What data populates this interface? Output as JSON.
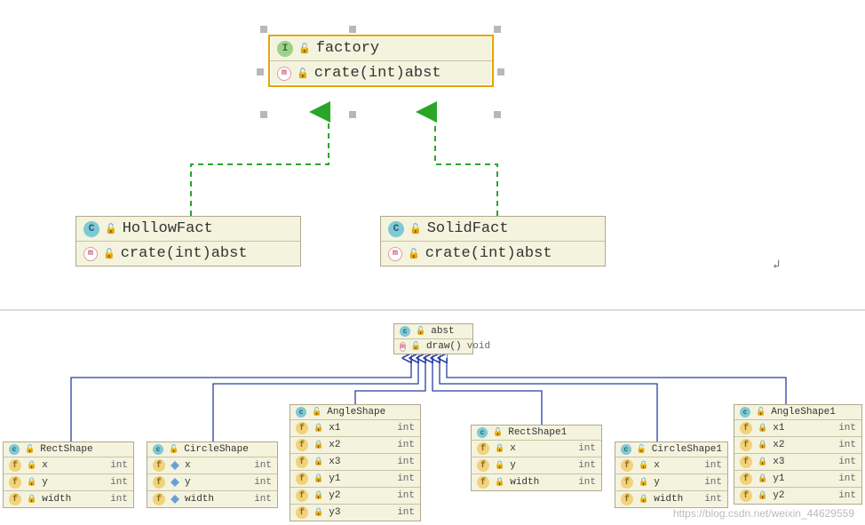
{
  "upper": {
    "factory": {
      "name": "factory",
      "method": "crate(int)abst",
      "kind": "I"
    },
    "hollow": {
      "name": "HollowFact",
      "method": "crate(int)abst",
      "kind": "C"
    },
    "solid": {
      "name": "SolidFact",
      "method": "crate(int)abst",
      "kind": "C"
    }
  },
  "lower": {
    "abst": {
      "name": "abst",
      "method": "draw()",
      "ret": "void"
    },
    "rect": {
      "name": "RectShape",
      "fields": [
        {
          "n": "x",
          "t": "int"
        },
        {
          "n": "y",
          "t": "int"
        },
        {
          "n": "width",
          "t": "int"
        }
      ]
    },
    "circle": {
      "name": "CircleShape",
      "fields": [
        {
          "n": "x",
          "t": "int"
        },
        {
          "n": "y",
          "t": "int"
        },
        {
          "n": "width",
          "t": "int"
        }
      ]
    },
    "angle": {
      "name": "AngleShape",
      "fields": [
        {
          "n": "x1",
          "t": "int"
        },
        {
          "n": "x2",
          "t": "int"
        },
        {
          "n": "x3",
          "t": "int"
        },
        {
          "n": "y1",
          "t": "int"
        },
        {
          "n": "y2",
          "t": "int"
        },
        {
          "n": "y3",
          "t": "int"
        }
      ]
    },
    "rect1": {
      "name": "RectShape1",
      "fields": [
        {
          "n": "x",
          "t": "int"
        },
        {
          "n": "y",
          "t": "int"
        },
        {
          "n": "width",
          "t": "int"
        }
      ]
    },
    "circle1": {
      "name": "CircleShape1",
      "fields": [
        {
          "n": "x",
          "t": "int"
        },
        {
          "n": "y",
          "t": "int"
        },
        {
          "n": "width",
          "t": "int"
        }
      ]
    },
    "angle1": {
      "name": "AngleShape1",
      "fields": [
        {
          "n": "x1",
          "t": "int"
        },
        {
          "n": "x2",
          "t": "int"
        },
        {
          "n": "x3",
          "t": "int"
        },
        {
          "n": "y1",
          "t": "int"
        },
        {
          "n": "y2",
          "t": "int"
        }
      ]
    }
  },
  "watermark": "https://blog.csdn.net/weixin_44629559",
  "chart_data": {
    "type": "uml-class-diagram",
    "diagrams": [
      {
        "title": "factory hierarchy",
        "nodes": [
          {
            "id": "factory",
            "stereotype": "interface",
            "name": "factory",
            "methods": [
              "crate(int) : abst"
            ]
          },
          {
            "id": "HollowFact",
            "stereotype": "class",
            "name": "HollowFact",
            "methods": [
              "crate(int) : abst"
            ]
          },
          {
            "id": "SolidFact",
            "stereotype": "class",
            "name": "SolidFact",
            "methods": [
              "crate(int) : abst"
            ]
          }
        ],
        "edges": [
          {
            "from": "HollowFact",
            "to": "factory",
            "kind": "realization"
          },
          {
            "from": "SolidFact",
            "to": "factory",
            "kind": "realization"
          }
        ]
      },
      {
        "title": "abst hierarchy",
        "nodes": [
          {
            "id": "abst",
            "stereotype": "class",
            "name": "abst",
            "methods": [
              "draw() : void"
            ]
          },
          {
            "id": "RectShape",
            "name": "RectShape",
            "fields": [
              [
                "x",
                "int"
              ],
              [
                "y",
                "int"
              ],
              [
                "width",
                "int"
              ]
            ]
          },
          {
            "id": "CircleShape",
            "name": "CircleShape",
            "fields": [
              [
                "x",
                "int"
              ],
              [
                "y",
                "int"
              ],
              [
                "width",
                "int"
              ]
            ]
          },
          {
            "id": "AngleShape",
            "name": "AngleShape",
            "fields": [
              [
                "x1",
                "int"
              ],
              [
                "x2",
                "int"
              ],
              [
                "x3",
                "int"
              ],
              [
                "y1",
                "int"
              ],
              [
                "y2",
                "int"
              ],
              [
                "y3",
                "int"
              ]
            ]
          },
          {
            "id": "RectShape1",
            "name": "RectShape1",
            "fields": [
              [
                "x",
                "int"
              ],
              [
                "y",
                "int"
              ],
              [
                "width",
                "int"
              ]
            ]
          },
          {
            "id": "CircleShape1",
            "name": "CircleShape1",
            "fields": [
              [
                "x",
                "int"
              ],
              [
                "y",
                "int"
              ],
              [
                "width",
                "int"
              ]
            ]
          },
          {
            "id": "AngleShape1",
            "name": "AngleShape1",
            "fields": [
              [
                "x1",
                "int"
              ],
              [
                "x2",
                "int"
              ],
              [
                "x3",
                "int"
              ],
              [
                "y1",
                "int"
              ],
              [
                "y2",
                "int"
              ]
            ]
          }
        ],
        "edges": [
          {
            "from": "RectShape",
            "to": "abst",
            "kind": "generalization"
          },
          {
            "from": "CircleShape",
            "to": "abst",
            "kind": "generalization"
          },
          {
            "from": "AngleShape",
            "to": "abst",
            "kind": "generalization"
          },
          {
            "from": "RectShape1",
            "to": "abst",
            "kind": "generalization"
          },
          {
            "from": "CircleShape1",
            "to": "abst",
            "kind": "generalization"
          },
          {
            "from": "AngleShape1",
            "to": "abst",
            "kind": "generalization"
          }
        ]
      }
    ]
  }
}
